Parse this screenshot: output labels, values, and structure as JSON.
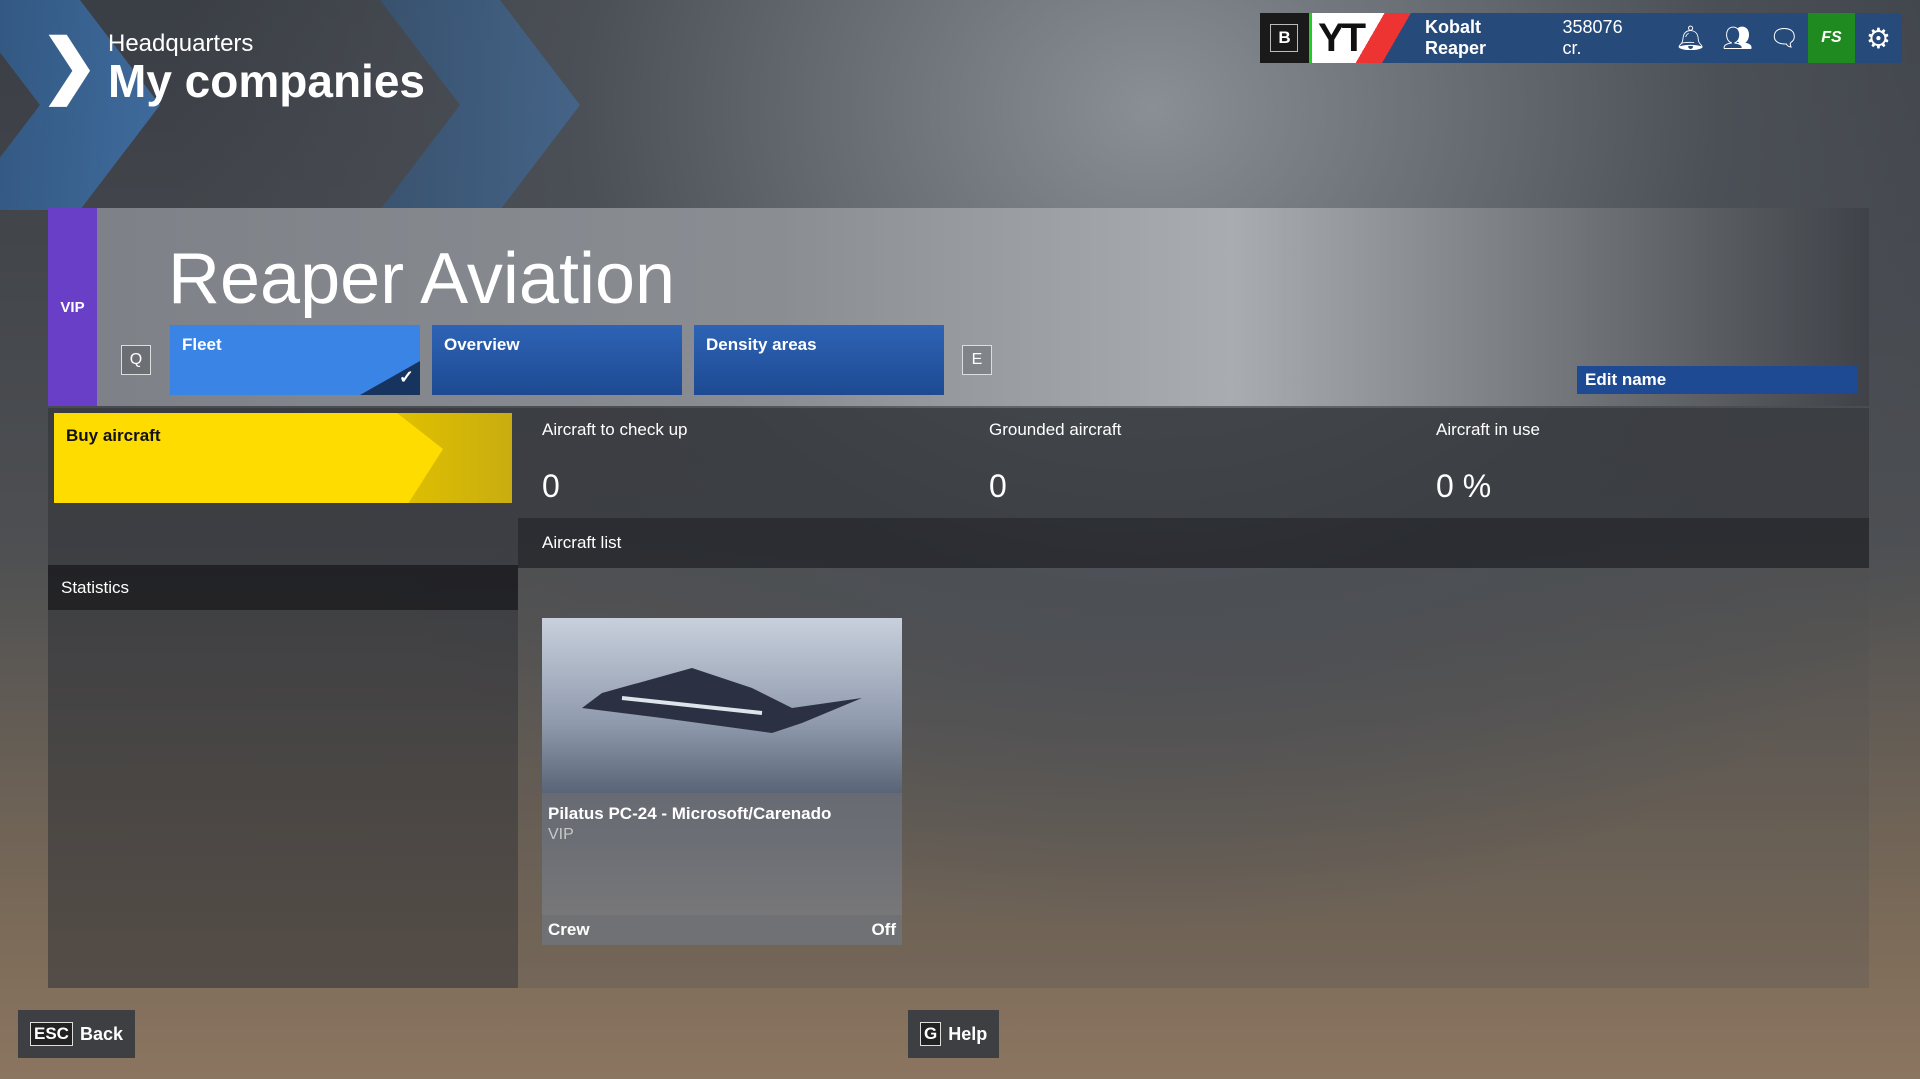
{
  "header": {
    "section": "Headquarters",
    "title": "My companies"
  },
  "topbar": {
    "key": "B",
    "logo_text": "YT",
    "username": "Kobalt Reaper",
    "credits": "358076 cr.",
    "icons": [
      "bell-icon",
      "friends-icon",
      "chat-icon",
      "marketplace-icon",
      "gear-icon"
    ],
    "marketplace_label": "FS"
  },
  "company": {
    "badge": "VIP",
    "name": "Reaper Aviation",
    "prev_key": "Q",
    "next_key": "E",
    "edit_name": "Edit name",
    "tabs": [
      {
        "label": "Fleet",
        "active": true
      },
      {
        "label": "Overview",
        "active": false
      },
      {
        "label": "Density areas",
        "active": false
      }
    ]
  },
  "sidebar": {
    "buy_label": "Buy aircraft",
    "statistics_label": "Statistics"
  },
  "stats": [
    {
      "label": "Aircraft to check up",
      "value": "0"
    },
    {
      "label": "Grounded aircraft",
      "value": "0"
    },
    {
      "label": "Aircraft in use",
      "value": "0 %"
    }
  ],
  "aircraft_list": {
    "title": "Aircraft list",
    "items": [
      {
        "name": "Pilatus PC-24 - Microsoft/Carenado",
        "category": "VIP",
        "crew_label": "Crew",
        "crew_value": "Off"
      }
    ]
  },
  "footer": {
    "back_key": "ESC",
    "back_label": "Back",
    "help_key": "G",
    "help_label": "Help"
  },
  "colors": {
    "accent_blue": "#3a84e6",
    "tab_blue": "#1d4a92",
    "vip_purple": "#6a3fc8",
    "buy_yellow": "#ffdc00",
    "market_green": "#1f8a1f"
  }
}
